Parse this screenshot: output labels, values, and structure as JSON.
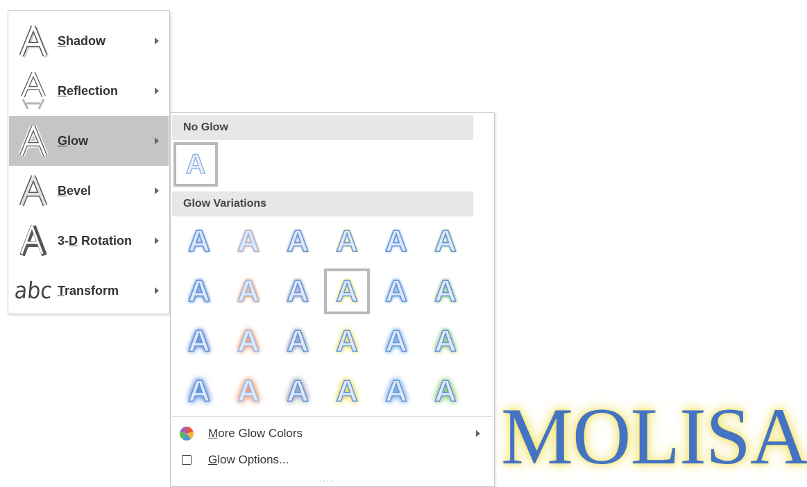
{
  "effects_menu": {
    "items": [
      {
        "underline": "S",
        "rest": "hadow",
        "active": false
      },
      {
        "underline": "R",
        "rest": "eflection",
        "active": false
      },
      {
        "underline": "G",
        "rest": "low",
        "active": true
      },
      {
        "underline": "B",
        "rest": "evel",
        "active": false
      },
      {
        "prefix": "3-",
        "underline": "D",
        "rest": " Rotation",
        "active": false
      },
      {
        "underline": "T",
        "rest": "ransform",
        "active": false
      }
    ],
    "transform_icon_text": "abc"
  },
  "glow_gallery": {
    "no_glow_header": "No Glow",
    "variations_header": "Glow Variations",
    "swatch_letter": "A",
    "glow_colors": [
      "#4a7fd6",
      "#ec8a52",
      "#8c96a4",
      "#ead93a",
      "#61a4e4",
      "#7ac35e"
    ],
    "selected_row": 1,
    "selected_col": 3,
    "more_colors": {
      "underline": "M",
      "rest": "ore Glow Colors"
    },
    "options": {
      "underline": "G",
      "rest": "low Options..."
    }
  },
  "sample_text": "MOLISA",
  "colors": {
    "active_item_bg": "#c5c5c5",
    "header_bg": "#e7e7e7",
    "sample_text_color": "#4473c4",
    "sample_glow": "#f3e670"
  }
}
